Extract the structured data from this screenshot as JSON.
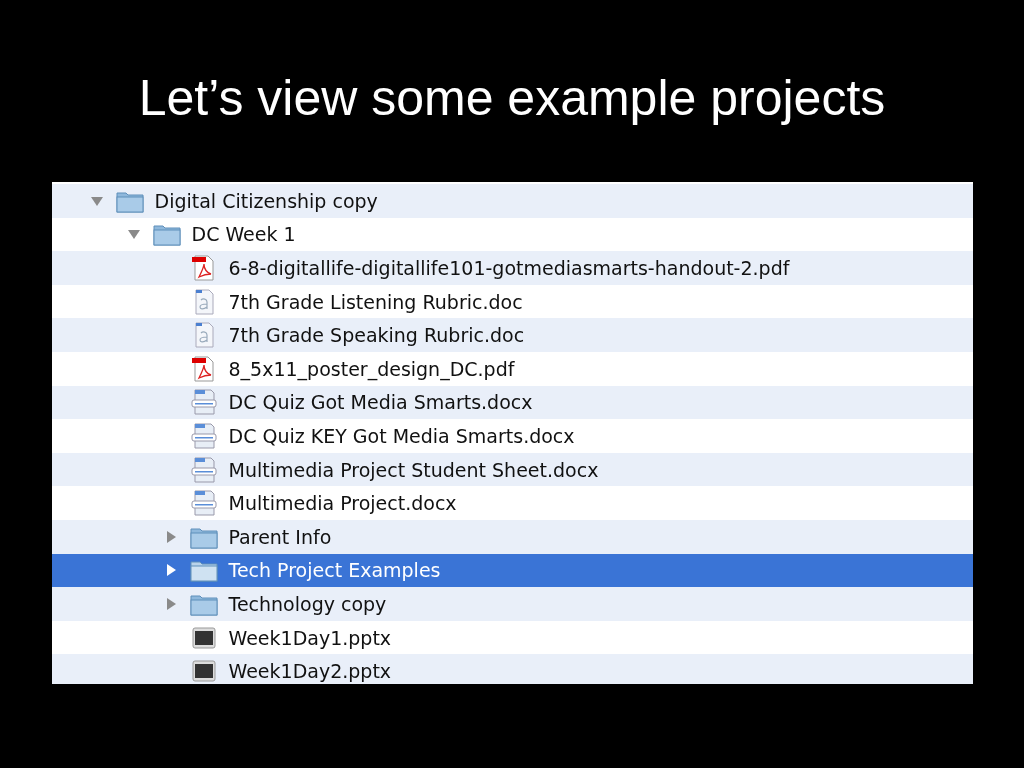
{
  "slide": {
    "title": "Let’s view some example projects"
  },
  "file_list": {
    "items": [
      {
        "kind": "folder",
        "name": "Digital Citizenship copy",
        "expanded": true,
        "selected": false,
        "children": [
          {
            "kind": "folder",
            "name": "DC Week 1",
            "expanded": true,
            "selected": false,
            "children": [
              {
                "kind": "pdf",
                "name": "6-8-digitallife-digitallife101-gotmediasmarts-handout-2.pdf",
                "selected": false
              },
              {
                "kind": "doc",
                "name": "7th Grade Listening Rubric.doc",
                "selected": false
              },
              {
                "kind": "doc",
                "name": "7th Grade Speaking Rubric.doc",
                "selected": false
              },
              {
                "kind": "pdf",
                "name": "8_5x11_poster_design_DC.pdf",
                "selected": false
              },
              {
                "kind": "docx",
                "name": "DC Quiz Got Media Smarts.docx",
                "selected": false
              },
              {
                "kind": "docx",
                "name": "DC Quiz KEY Got Media Smarts.docx",
                "selected": false
              },
              {
                "kind": "docx",
                "name": "Multimedia Project Student Sheet.docx",
                "selected": false
              },
              {
                "kind": "docx",
                "name": "Multimedia Project.docx",
                "selected": false
              },
              {
                "kind": "folder",
                "name": "Parent Info",
                "expanded": false,
                "selected": false
              },
              {
                "kind": "folder",
                "name": "Tech Project Examples",
                "expanded": false,
                "selected": true
              },
              {
                "kind": "folder",
                "name": "Technology copy",
                "expanded": false,
                "selected": false
              },
              {
                "kind": "pptx",
                "name": "Week1Day1.pptx",
                "selected": false
              },
              {
                "kind": "pptx",
                "name": "Week1Day2.pptx",
                "selected": false
              }
            ]
          }
        ]
      }
    ]
  }
}
